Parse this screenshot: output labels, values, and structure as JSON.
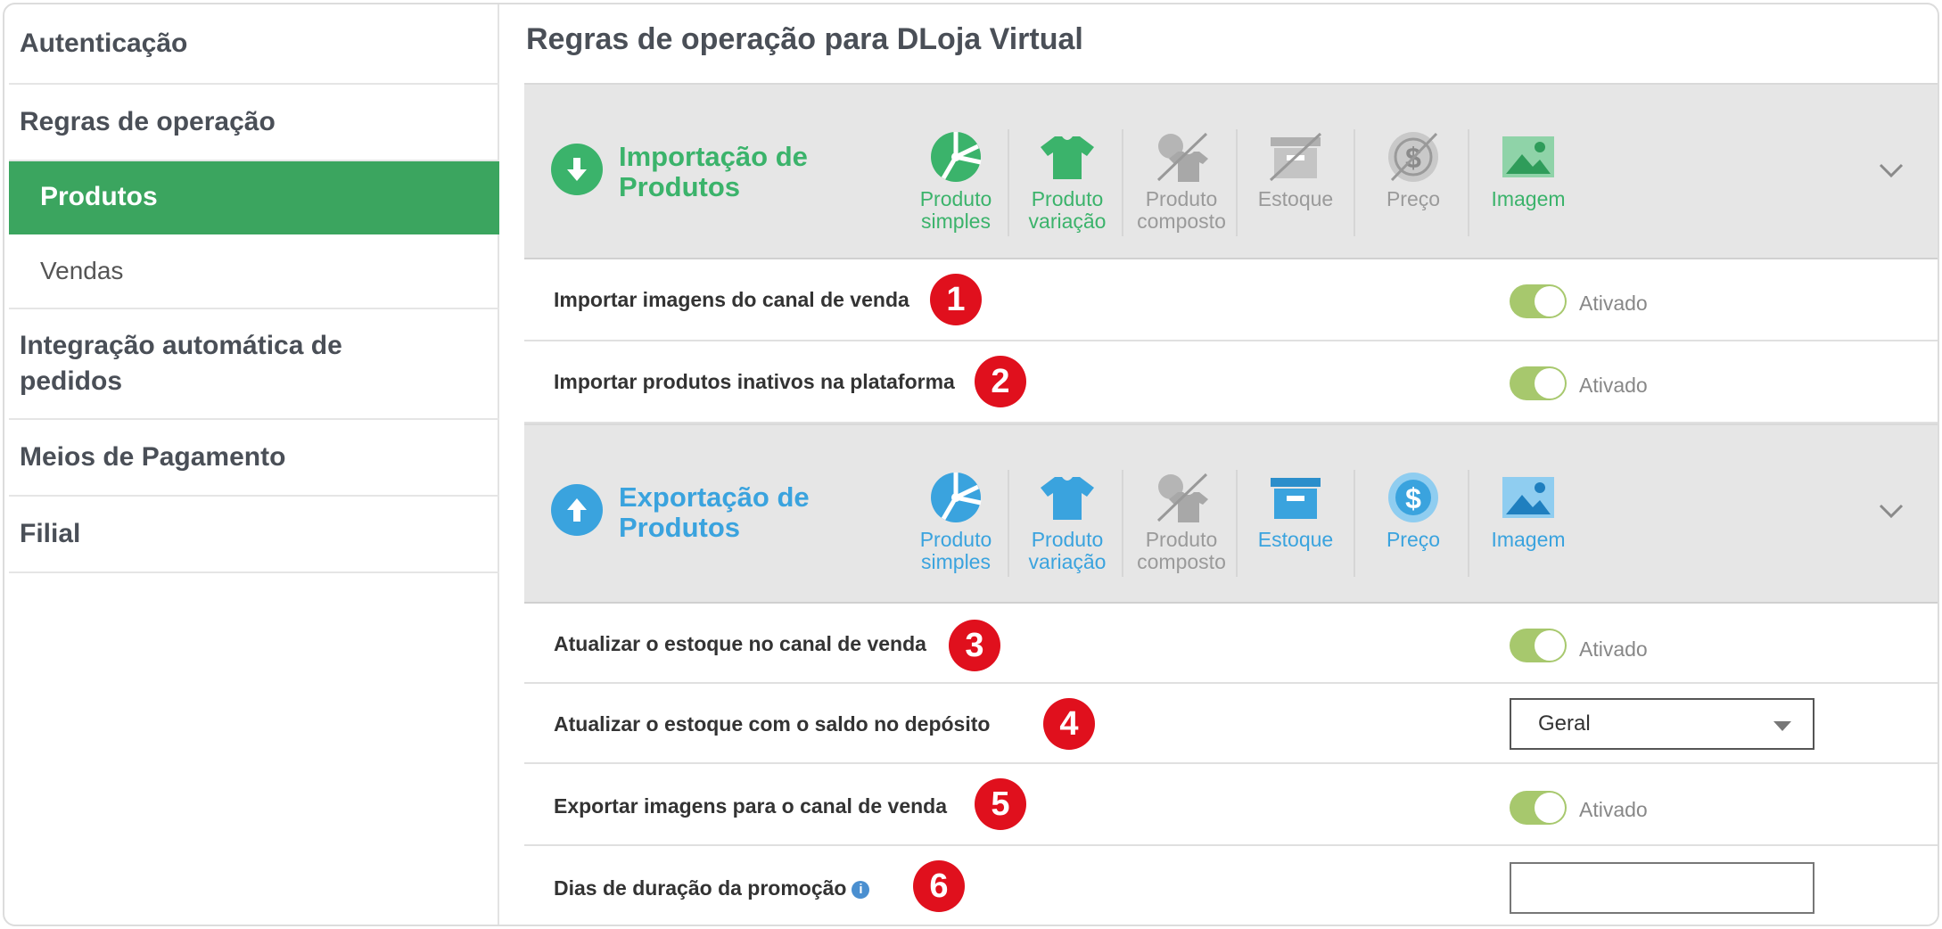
{
  "sidebar": {
    "items": [
      {
        "label": "Autenticação"
      },
      {
        "label": "Regras de operação"
      },
      {
        "label": "Produtos"
      },
      {
        "label": "Vendas"
      },
      {
        "label": "Integração automática de pedidos"
      },
      {
        "label": "Meios de Pagamento"
      },
      {
        "label": "Filial"
      }
    ]
  },
  "page": {
    "title": "Regras de operação para DLoja Virtual"
  },
  "import_section": {
    "title_line1": "Importação de",
    "title_line2": "Produtos",
    "color": "#3bb36b",
    "tiles": [
      {
        "line1": "Produto",
        "line2": "simples",
        "icon": "ball-icon",
        "enabled": true
      },
      {
        "line1": "Produto",
        "line2": "variação",
        "icon": "tshirt-icon",
        "enabled": true
      },
      {
        "line1": "Produto",
        "line2": "composto",
        "icon": "composite-product-icon",
        "enabled": false
      },
      {
        "line1": "Estoque",
        "line2": "",
        "icon": "stock-box-icon",
        "enabled": false
      },
      {
        "line1": "Preço",
        "line2": "",
        "icon": "price-coin-icon",
        "enabled": false
      },
      {
        "line1": "Imagem",
        "line2": "",
        "icon": "image-icon",
        "enabled": true
      }
    ]
  },
  "export_section": {
    "title_line1": "Exportação de",
    "title_line2": "Produtos",
    "color": "#3aa3de",
    "tiles": [
      {
        "line1": "Produto",
        "line2": "simples",
        "icon": "ball-icon",
        "enabled": true
      },
      {
        "line1": "Produto",
        "line2": "variação",
        "icon": "tshirt-icon",
        "enabled": true
      },
      {
        "line1": "Produto",
        "line2": "composto",
        "icon": "composite-product-icon",
        "enabled": false
      },
      {
        "line1": "Estoque",
        "line2": "",
        "icon": "stock-box-icon",
        "enabled": true
      },
      {
        "line1": "Preço",
        "line2": "",
        "icon": "price-coin-icon",
        "enabled": true
      },
      {
        "line1": "Imagem",
        "line2": "",
        "icon": "image-icon",
        "enabled": true
      }
    ]
  },
  "rows": [
    {
      "label": "Importar imagens do canal de venda",
      "badge": "1",
      "control": "toggle",
      "value": "Ativado"
    },
    {
      "label": "Importar produtos inativos na plataforma",
      "badge": "2",
      "control": "toggle",
      "value": "Ativado"
    },
    {
      "label": "Atualizar o estoque no canal de venda",
      "badge": "3",
      "control": "toggle",
      "value": "Ativado"
    },
    {
      "label": "Atualizar o estoque com o saldo no depósito",
      "badge": "4",
      "control": "select",
      "value": "Geral"
    },
    {
      "label": "Exportar imagens para o canal de venda",
      "badge": "5",
      "control": "toggle",
      "value": "Ativado"
    },
    {
      "label": "Dias de duração da promoção",
      "badge": "6",
      "control": "text",
      "value": ""
    }
  ],
  "colors": {
    "active_nav": "#3ba55f",
    "toggle_on": "#a7c86d",
    "badge": "#e0101d"
  }
}
